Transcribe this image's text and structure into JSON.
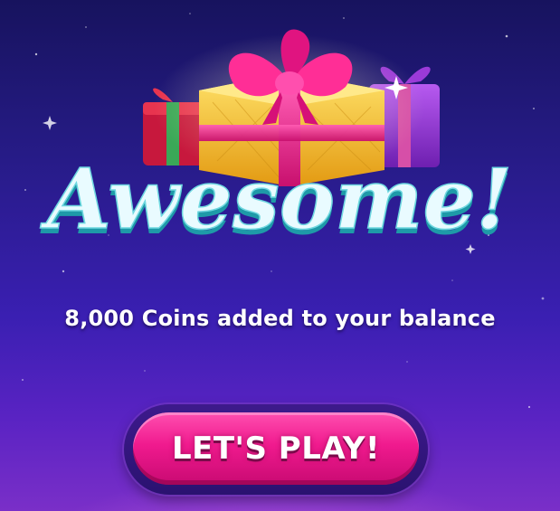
{
  "popup": {
    "title": "Awesome!",
    "message": "8,000 Coins added to your balance",
    "play_button_label": "LET'S PLAY!"
  },
  "icons": {
    "hero_graphic": "gift-boxes-icon"
  },
  "colors": {
    "background_top": "#17135e",
    "background_bottom": "#7a2fc8",
    "title_fill": "#e9fbff",
    "title_shadow": "#2bc0c9",
    "button_pink": "#f01a8e",
    "button_ring": "#3d1a8c",
    "gift_gold": "#f5c433",
    "ribbon_pink": "#ff2e96",
    "gift_purple": "#9a36d8"
  }
}
